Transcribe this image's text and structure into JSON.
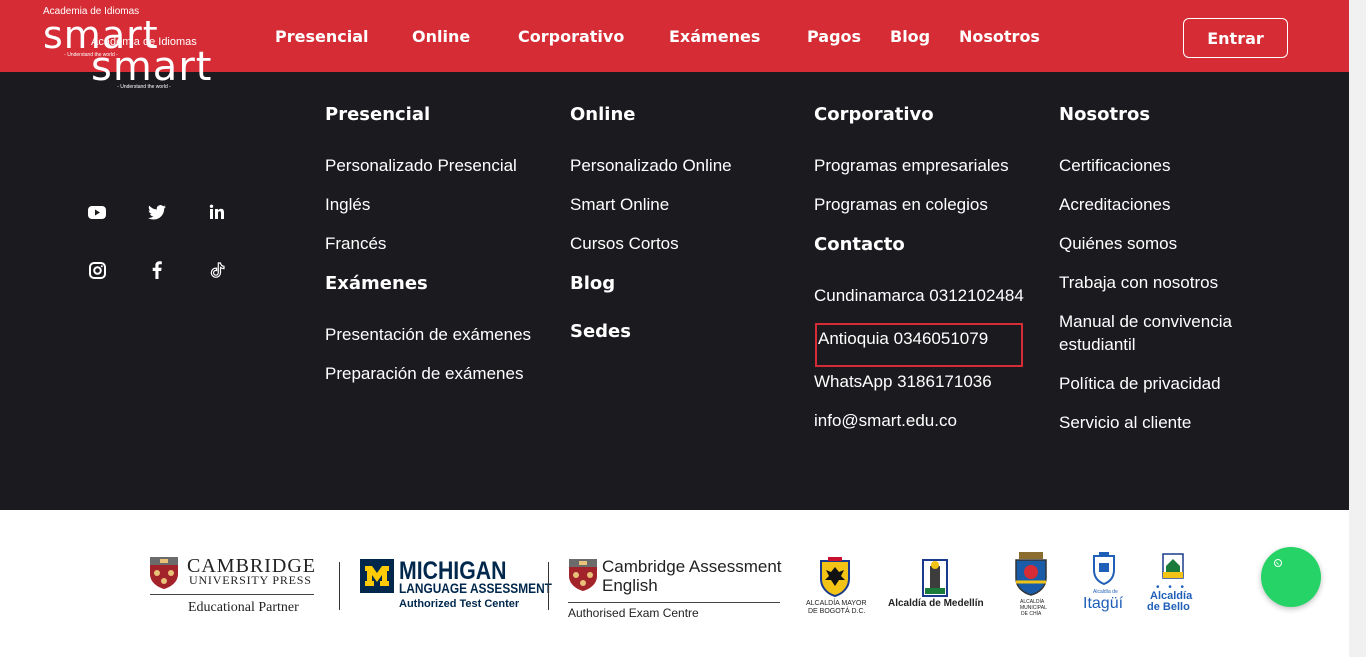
{
  "colors": {
    "brand_red": "#d62c35",
    "footer_bg": "#1b1a1f",
    "whatsapp_green": "#25d366"
  },
  "brand": {
    "small": "Academia de Idiomas",
    "name": "smart",
    "tagline": "- Understand the world -"
  },
  "nav": {
    "items": [
      "Presencial",
      "Online",
      "Corporativo",
      "Exámenes",
      "Pagos",
      "Blog",
      "Nosotros"
    ],
    "login": "Entrar"
  },
  "footer": {
    "social_icons": [
      "youtube-icon",
      "twitter-icon",
      "linkedin-icon",
      "instagram-icon",
      "facebook-icon",
      "tiktok-icon"
    ],
    "presencial": {
      "title": "Presencial",
      "links": [
        "Personalizado Presencial",
        "Inglés",
        "Francés"
      ]
    },
    "examenes": {
      "title": "Exámenes",
      "links": [
        "Presentación de exámenes",
        "Preparación de exámenes"
      ]
    },
    "online": {
      "title": "Online",
      "links": [
        "Personalizado Online",
        "Smart Online",
        "Cursos Cortos"
      ]
    },
    "blog": {
      "title": "Blog"
    },
    "sedes": {
      "title": "Sedes"
    },
    "corporativo": {
      "title": "Corporativo",
      "links": [
        "Programas empresariales",
        "Programas en colegios"
      ]
    },
    "contacto": {
      "title": "Contacto",
      "items": [
        "Cundinamarca 0312102484",
        "Antioquia 0346051079",
        "WhatsApp 3186171036",
        "info@smart.edu.co"
      ]
    },
    "nosotros": {
      "title": "Nosotros",
      "links": [
        "Certificaciones",
        "Acreditaciones",
        "Quiénes somos",
        "Trabaja con nosotros",
        "Manual de convivencia estudiantil",
        "Política de privacidad",
        "Servicio al cliente"
      ]
    }
  },
  "partners": {
    "cambridge_press": {
      "line1": "CAMBRIDGE",
      "line2": "UNIVERSITY PRESS",
      "line3": "Educational Partner"
    },
    "michigan": {
      "line1": "MICHIGAN",
      "line2": "LANGUAGE ASSESSMENT",
      "line3": "Authorized Test Center"
    },
    "cambridge_assessment": {
      "line1": "Cambridge Assessment",
      "line2": "English",
      "line3": "Authorised Exam Centre"
    },
    "bogota": {
      "line1": "ALCALDÍA MAYOR",
      "line2": "DE BOGOTÁ D.C."
    },
    "medellin": {
      "text": "Alcaldía de Medellín"
    },
    "chia": {
      "line1": "ALCALDÍA",
      "line2": "MUNICIPAL",
      "line3": "DE CHÍA"
    },
    "itagui": {
      "small": "Alcaldía de",
      "big": "Itagüí"
    },
    "bello": {
      "line1": "Alcaldía",
      "line2": "de Bello"
    }
  },
  "whatsapp": {
    "icon": "whatsapp-icon"
  }
}
